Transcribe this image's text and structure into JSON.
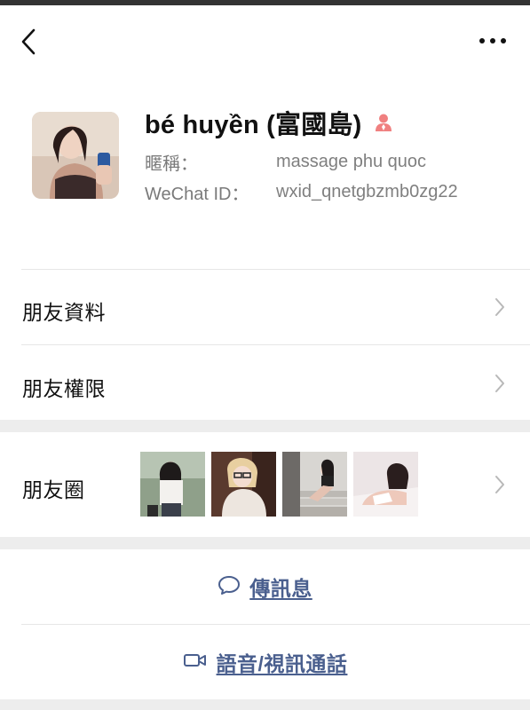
{
  "nav": {
    "back_icon": "chevron-left-icon",
    "more_icon": "more-dots-icon"
  },
  "profile": {
    "name": "bé huyền (富國島)",
    "gender_icon": "female-person-icon",
    "nickname_label": "暱稱：",
    "nickname_value": "massage phu quoc",
    "wechat_id_label": "WeChat ID：",
    "wechat_id_value": "wxid_qnetgbzmb0zg22"
  },
  "rows": {
    "friend_info": "朋友資料",
    "friend_permissions": "朋友權限",
    "moments": "朋友圈"
  },
  "actions": {
    "message": "傳訊息",
    "call": "語音/視訊通話"
  },
  "colors": {
    "accent_link": "#4a5f8e",
    "gender_female": "#f08080",
    "section_gap": "#ededed"
  }
}
